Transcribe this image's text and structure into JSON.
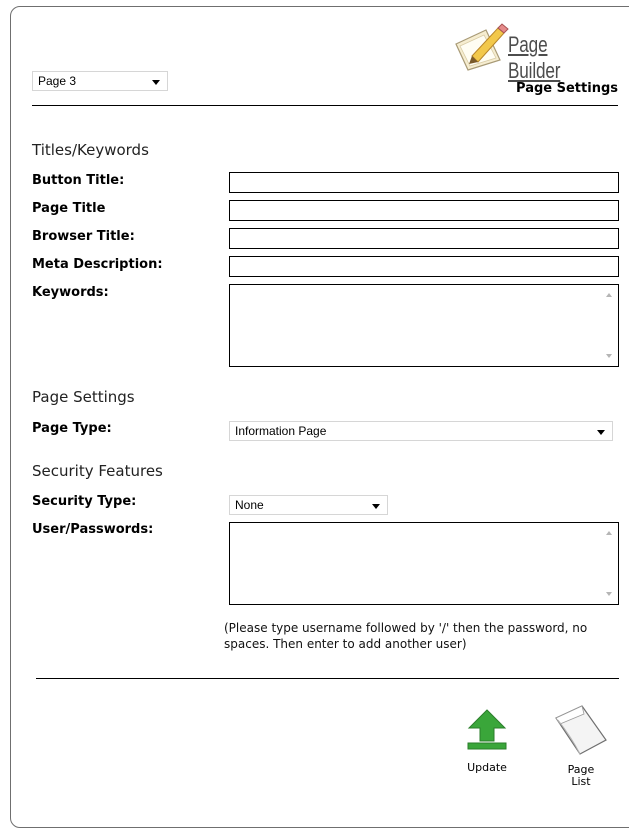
{
  "header": {
    "brand": "Page Builder",
    "page_select": "Page 3",
    "section_title": "Page Settings"
  },
  "titles_keywords": {
    "heading": "Titles/Keywords",
    "button_title_label": "Button Title:",
    "button_title_value": "",
    "page_title_label": "Page Title",
    "page_title_value": "",
    "browser_title_label": "Browser Title:",
    "browser_title_value": "",
    "meta_description_label": "Meta Description:",
    "meta_description_value": "",
    "keywords_label": "Keywords:",
    "keywords_value": ""
  },
  "page_settings": {
    "heading": "Page Settings",
    "page_type_label": "Page Type:",
    "page_type_value": "Information Page"
  },
  "security": {
    "heading": "Security Features",
    "security_type_label": "Security Type:",
    "security_type_value": "None",
    "users_label": "User/Passwords:",
    "users_value": "",
    "help_text": "(Please type username followed by '/' then the password, no spaces. Then enter to add another user)"
  },
  "actions": {
    "update_label": "Update",
    "page_list_line1": "Page",
    "page_list_line2": "List"
  },
  "icons": {
    "logo": "pencil-paper-icon",
    "update": "green-upload-arrow-icon",
    "page_list": "page-icon"
  },
  "colors": {
    "accent_green": "#3aa63a",
    "brand_text": "#4d4d4d"
  }
}
